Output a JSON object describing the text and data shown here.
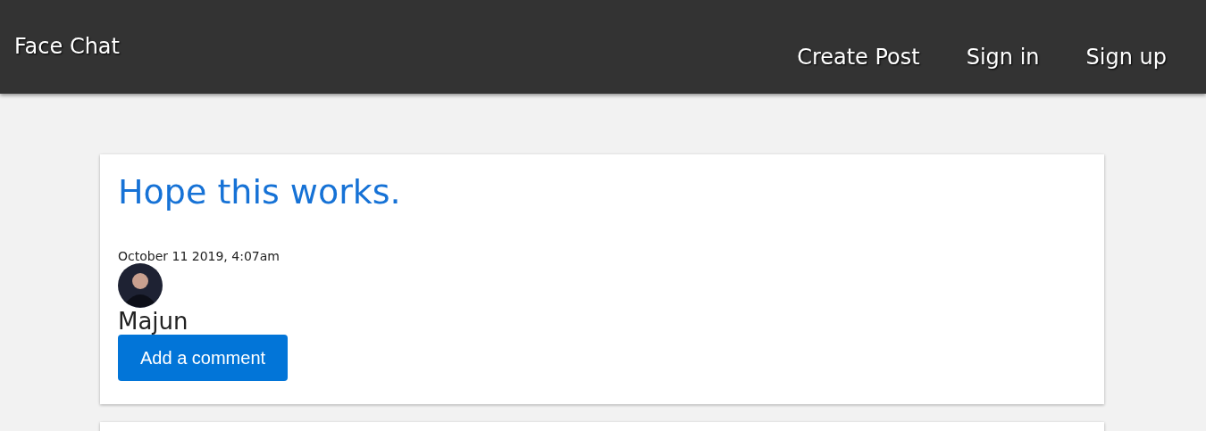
{
  "header": {
    "brand": "Face Chat",
    "nav": [
      "Create Post",
      "Sign in",
      "Sign up"
    ]
  },
  "posts": [
    {
      "title": "Hope this works.",
      "date": "October 11 2019, 4:07am",
      "author": "Majun",
      "button": "Add a comment"
    }
  ]
}
